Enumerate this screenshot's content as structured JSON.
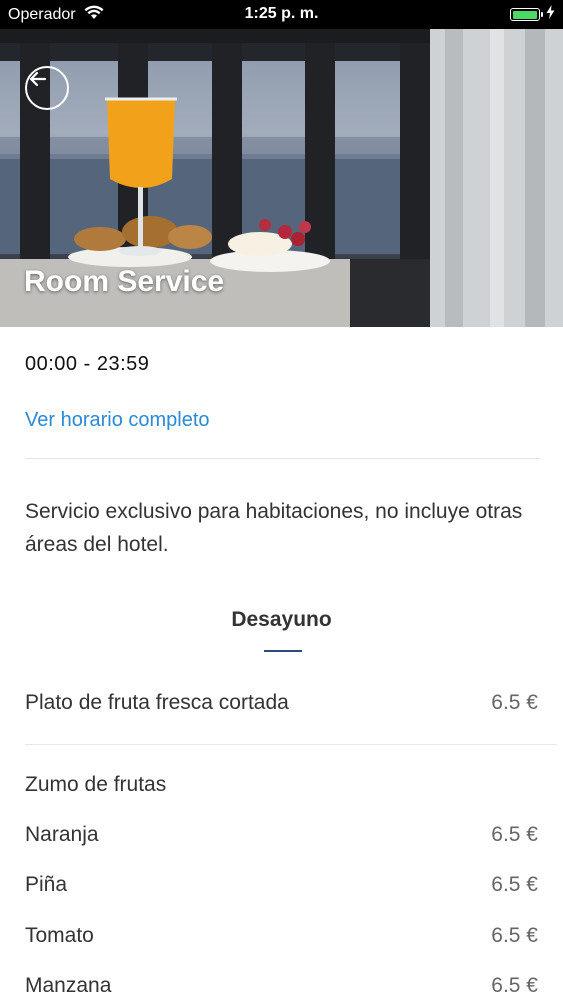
{
  "status_bar": {
    "carrier": "Operador",
    "time": "1:25 p. m.",
    "battery_color": "#4cd964"
  },
  "hero": {
    "title": "Room Service",
    "back_icon": "arrow-left-icon"
  },
  "info": {
    "hours": "00:00 - 23:59",
    "hours_link": "Ver horario completo",
    "description": "Servicio exclusivo para habitaciones, no incluye otras áreas del hotel.",
    "link_color": "#2a8ad6"
  },
  "menu": {
    "section_title": "Desayuno",
    "underline_color": "#2c4a7a",
    "items": [
      {
        "name": "Plato de fruta fresca cortada",
        "price": "6.5 €"
      }
    ],
    "group_title": "Zumo de frutas",
    "group_items": [
      {
        "name": "Naranja",
        "price": "6.5 €"
      },
      {
        "name": "Piña",
        "price": "6.5 €"
      },
      {
        "name": "Tomato",
        "price": "6.5 €"
      },
      {
        "name": "Manzana",
        "price": "6.5 €"
      }
    ]
  }
}
